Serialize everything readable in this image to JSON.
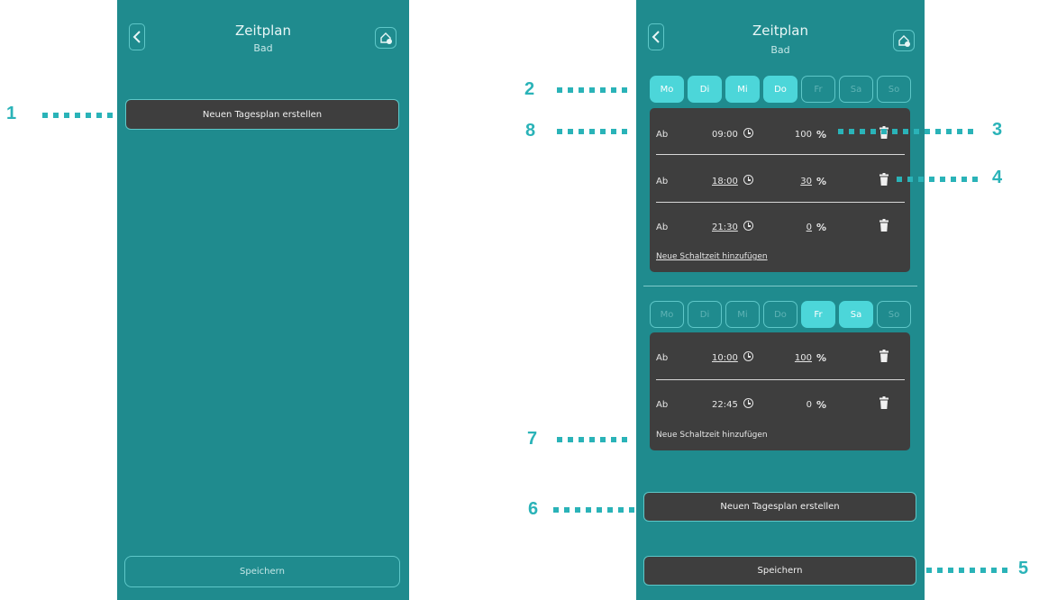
{
  "left_screen": {
    "title": "Zeitplan",
    "subtitle": "Bad",
    "new_plan_label": "Neuen Tagesplan erstellen",
    "save_label": "Speichern"
  },
  "right_screen": {
    "title": "Zeitplan",
    "subtitle": "Bad",
    "plans": [
      {
        "days": [
          {
            "label": "Mo",
            "active": true
          },
          {
            "label": "Di",
            "active": true
          },
          {
            "label": "Mi",
            "active": true
          },
          {
            "label": "Do",
            "active": true
          },
          {
            "label": "Fr",
            "active": false
          },
          {
            "label": "Sa",
            "active": false
          },
          {
            "label": "So",
            "active": false
          }
        ],
        "entries": [
          {
            "prefix": "Ab",
            "time": "09:00",
            "value": "100",
            "unit": "%"
          },
          {
            "prefix": "Ab",
            "time": "18:00",
            "value": "30",
            "unit": "%"
          },
          {
            "prefix": "Ab",
            "time": "21:30",
            "value": "0",
            "unit": "%"
          }
        ],
        "add_label": "Neue Schaltzeit hinzufügen"
      },
      {
        "days": [
          {
            "label": "Mo",
            "active": false
          },
          {
            "label": "Di",
            "active": false
          },
          {
            "label": "Mi",
            "active": false
          },
          {
            "label": "Do",
            "active": false
          },
          {
            "label": "Fr",
            "active": true
          },
          {
            "label": "Sa",
            "active": true
          },
          {
            "label": "So",
            "active": false
          }
        ],
        "entries": [
          {
            "prefix": "Ab",
            "time": "10:00",
            "value": "100",
            "unit": "%"
          },
          {
            "prefix": "Ab",
            "time": "22:45",
            "value": "0",
            "unit": "%"
          }
        ],
        "add_label": "Neue Schaltzeit hinzufügen"
      }
    ],
    "new_plan_label": "Neuen Tagesplan erstellen",
    "save_label": "Speichern"
  },
  "callouts": [
    "1",
    "2",
    "3",
    "4",
    "5",
    "6",
    "7",
    "8"
  ],
  "colors": {
    "screen_bg": "#1f8b8e",
    "accent": "#4cd6d9",
    "card_bg": "#3e3e3e",
    "callout": "#2ab3b8"
  },
  "icons": {
    "back": "chevron-left-icon",
    "home": "home-settings-icon",
    "clock": "clock-icon",
    "delete": "trash-icon"
  }
}
